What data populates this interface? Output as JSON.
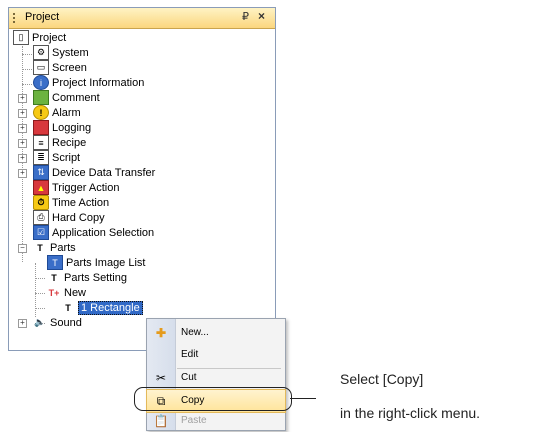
{
  "panel": {
    "title": "Project",
    "pin_glyph": "ᵖ",
    "close_glyph": "✕"
  },
  "tree": {
    "root": "Project",
    "system": "System",
    "screen": "Screen",
    "project_information": "Project Information",
    "comment": "Comment",
    "alarm": "Alarm",
    "logging": "Logging",
    "recipe": "Recipe",
    "script": "Script",
    "device_data_transfer": "Device Data Transfer",
    "trigger_action": "Trigger Action",
    "time_action": "Time Action",
    "hard_copy": "Hard Copy",
    "application_selection": "Application Selection",
    "parts": "Parts",
    "parts_image_list": "Parts Image List",
    "parts_setting": "Parts Setting",
    "new": "New",
    "rectangle": "1 Rectangle",
    "sound": "Sound"
  },
  "context_menu": {
    "new": "New...",
    "edit": "Edit",
    "cut": "Cut",
    "copy": "Copy",
    "paste": "Paste"
  },
  "annotation": {
    "line1": "Select [Copy]",
    "line2": "in the right-click menu."
  },
  "colors": {
    "selection": "#3169c6",
    "menu_highlight": "#ffe49a",
    "header": "#fbd67e"
  }
}
